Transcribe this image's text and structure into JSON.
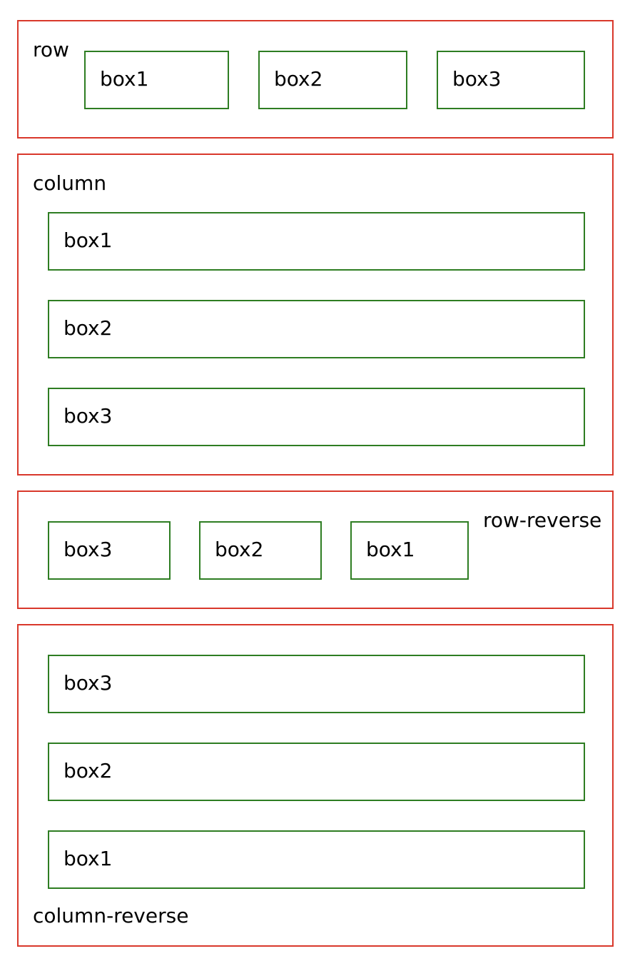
{
  "row": {
    "label": "row",
    "boxes": [
      "box1",
      "box2",
      "box3"
    ]
  },
  "column": {
    "label": "column",
    "boxes": [
      "box1",
      "box2",
      "box3"
    ]
  },
  "row_reverse": {
    "label": "row-reverse",
    "boxes": [
      "box3",
      "box2",
      "box1"
    ]
  },
  "column_reverse": {
    "label": "column-reverse",
    "boxes": [
      "box3",
      "box2",
      "box1"
    ]
  },
  "colors": {
    "container_border": "#d9382b",
    "box_border": "#2e7d22",
    "text": "#000000"
  }
}
